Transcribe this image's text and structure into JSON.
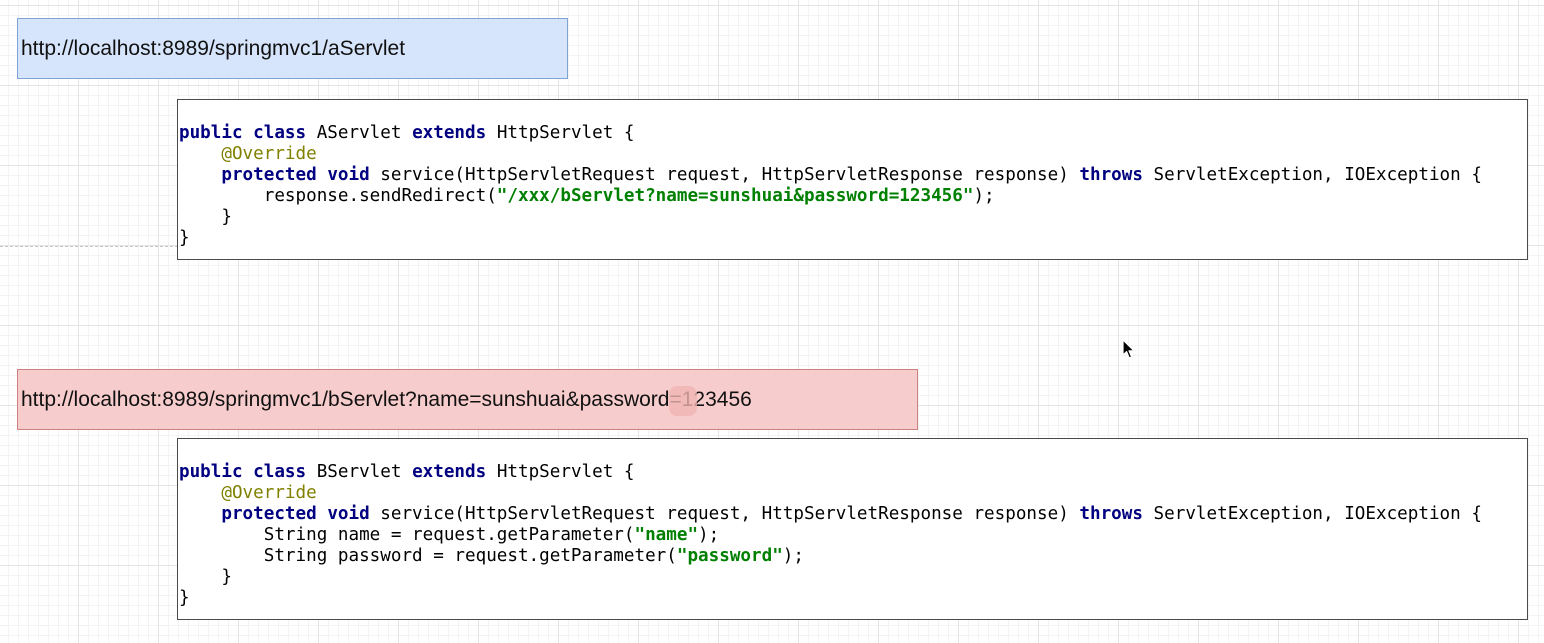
{
  "url_a": "http://localhost:8989/springmvc1/aServlet",
  "url_b": "http://localhost:8989/springmvc1/bServlet?name=sunshuai&password=123456",
  "code_a": {
    "class_decl": {
      "kw1": "public",
      "kw2": "class",
      "name": "AServlet",
      "kw3": "extends",
      "parent": "HttpServlet {"
    },
    "annotation": "@Override",
    "method": {
      "kw1": "protected",
      "kw2": "void",
      "signature": "service(HttpServletRequest request, HttpServletResponse response)",
      "kw3": "throws",
      "exceptions": "ServletException, IOException {"
    },
    "redirect": {
      "call": "response.sendRedirect(",
      "arg": "\"/xxx/bServlet?name=sunshuai&password=123456\"",
      "end": ");"
    },
    "method_close": "}",
    "class_close": "}"
  },
  "code_b": {
    "class_decl": {
      "kw1": "public",
      "kw2": "class",
      "name": "BServlet",
      "kw3": "extends",
      "parent": "HttpServlet {"
    },
    "annotation": "@Override",
    "method": {
      "kw1": "protected",
      "kw2": "void",
      "signature": "service(HttpServletRequest request, HttpServletResponse response)",
      "kw3": "throws",
      "exceptions": "ServletException, IOException {"
    },
    "line_name": {
      "decl": "String name = request.getParameter(",
      "arg": "\"name\"",
      "end": ");"
    },
    "line_password": {
      "decl": "String password = request.getParameter(",
      "arg": "\"password\"",
      "end": ");"
    },
    "method_close": "}",
    "class_close": "}"
  },
  "colors": {
    "url_a_fill": "#d6e5fb",
    "url_b_fill": "#f7cccc",
    "keyword": "#000080",
    "annotation": "#808000",
    "string": "#008000"
  },
  "icons": {
    "cursor": "mouse-pointer-icon"
  }
}
